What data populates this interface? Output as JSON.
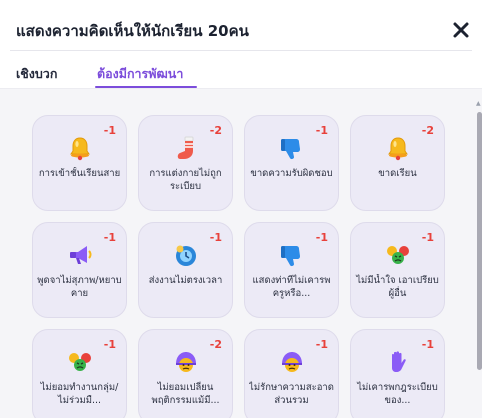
{
  "modal": {
    "title": "แสดงความคิดเห็นให้นักเรียน 20คน",
    "close_icon": "close-icon"
  },
  "tabs": [
    {
      "label": "เชิงบวก",
      "active": false
    },
    {
      "label": "ต้องมีการพัฒนา",
      "active": true
    }
  ],
  "colors": {
    "accent": "#7c4ddb",
    "points": "#e8413b",
    "card_bg": "#eceaf6"
  },
  "cards": [
    {
      "label": "การเข้าชั้นเรียนสาย",
      "points": "-1",
      "icon": "bell-icon"
    },
    {
      "label": "การแต่งกายไม่ถูกระเบียบ",
      "points": "-2",
      "icon": "sock-icon"
    },
    {
      "label": "ขาดความรับผิดชอบ",
      "points": "-1",
      "icon": "thumbs-down-icon"
    },
    {
      "label": "ขาดเรียน",
      "points": "-2",
      "icon": "bell-icon"
    },
    {
      "label": "พูดจาไม่สุภาพ/หยาบคาย",
      "points": "-1",
      "icon": "megaphone-icon"
    },
    {
      "label": "ส่งงานไม่ตรงเวลา",
      "points": "-1",
      "icon": "clock-face-icon"
    },
    {
      "label": "แสดงท่าทีไม่เคารพครูหรือ...",
      "points": "-1",
      "icon": "thumbs-down-icon"
    },
    {
      "label": "ไม่มีน้ำใจ เอาเปรียบผู้อื่น",
      "points": "-1",
      "icon": "angry-group-icon"
    },
    {
      "label": "ไม่ยอมทำงานกลุ่ม/ไม่ร่วมมื...",
      "points": "-1",
      "icon": "angry-group-icon"
    },
    {
      "label": "ไม่ยอมเปลี่ยนพฤติกรรมแม้มี...",
      "points": "-2",
      "icon": "helmet-face-icon"
    },
    {
      "label": "ไม่รักษาความสะอาดส่วนรวม",
      "points": "-1",
      "icon": "helmet-face-icon"
    },
    {
      "label": "ไม่เคารพกฎระเบียบของ...",
      "points": "-1",
      "icon": "stop-hand-icon"
    }
  ]
}
